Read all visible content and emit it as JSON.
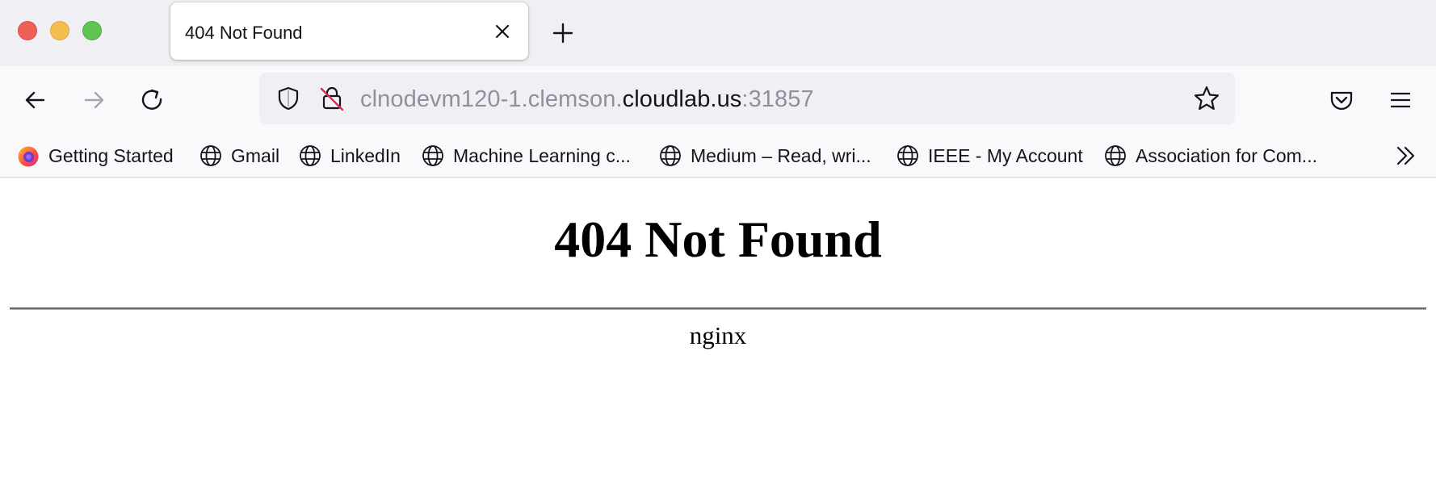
{
  "window": {
    "traffic_lights": [
      "close",
      "minimize",
      "zoom"
    ],
    "colors": {
      "close": "#ee5f57",
      "minimize": "#f5bf4f",
      "zoom": "#5fc454"
    }
  },
  "tab": {
    "title": "404 Not Found",
    "close_icon": "close-icon"
  },
  "new_tab_icon": "plus-icon",
  "nav": {
    "back_icon": "arrow-left-icon",
    "forward_icon": "arrow-right-icon",
    "reload_icon": "reload-icon"
  },
  "urlbar": {
    "url_prefix": "clnodevm120-1.clemson.",
    "url_domain": "cloudlab.us",
    "url_port": ":31857",
    "shield_icon": "shield-icon",
    "insecure_lock_icon": "insecure-lock-icon",
    "bookmark_star_icon": "star-icon"
  },
  "toolbar": {
    "pocket_icon": "pocket-icon",
    "menu_icon": "hamburger-menu-icon"
  },
  "bookmarks": {
    "items": [
      {
        "label": "Getting Started",
        "icon": "firefox-icon"
      },
      {
        "label": "Gmail",
        "icon": "globe-icon"
      },
      {
        "label": "LinkedIn",
        "icon": "globe-icon"
      },
      {
        "label": "Machine Learning c...",
        "icon": "globe-icon"
      },
      {
        "label": "Medium – Read, wri...",
        "icon": "globe-icon"
      },
      {
        "label": "IEEE - My Account",
        "icon": "globe-icon"
      },
      {
        "label": "Association for Com...",
        "icon": "globe-icon"
      }
    ],
    "overflow_icon": "chevron-double-right-icon"
  },
  "page": {
    "heading": "404 Not Found",
    "server": "nginx"
  }
}
